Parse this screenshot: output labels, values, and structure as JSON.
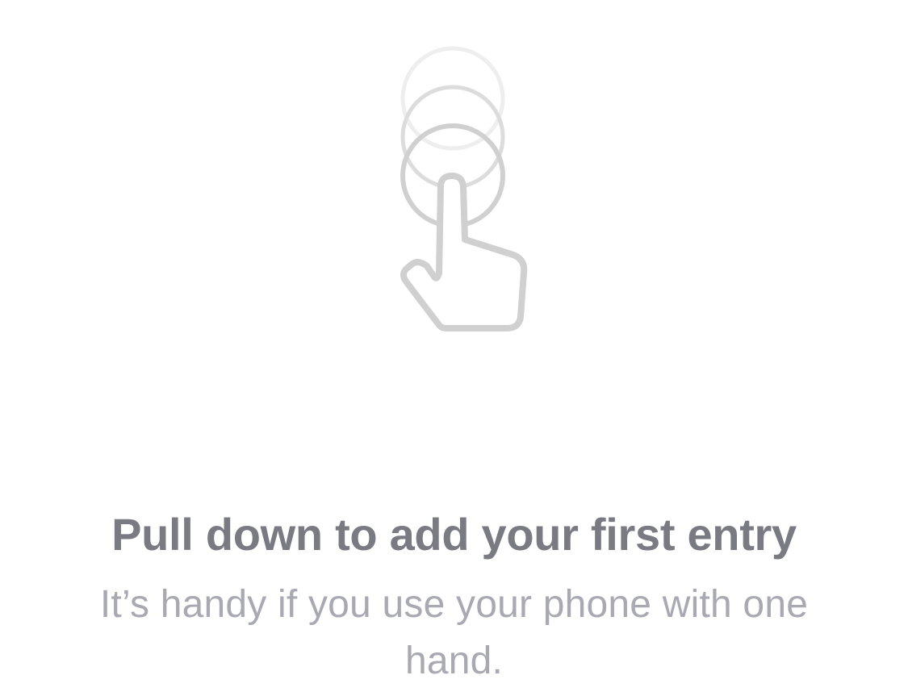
{
  "empty_state": {
    "icon": "tap-hand-icon",
    "title": "Pull down to add your first entry",
    "subtitle": "It’s handy if you use your phone with one hand."
  },
  "colors": {
    "background": "#ffffff",
    "title": "#7a7a83",
    "subtitle": "#a9a9b2",
    "icon_stroke": "#d0d0d0",
    "icon_stroke_faint": "#eeeeee",
    "icon_stroke_mid": "#dcdcdc"
  }
}
